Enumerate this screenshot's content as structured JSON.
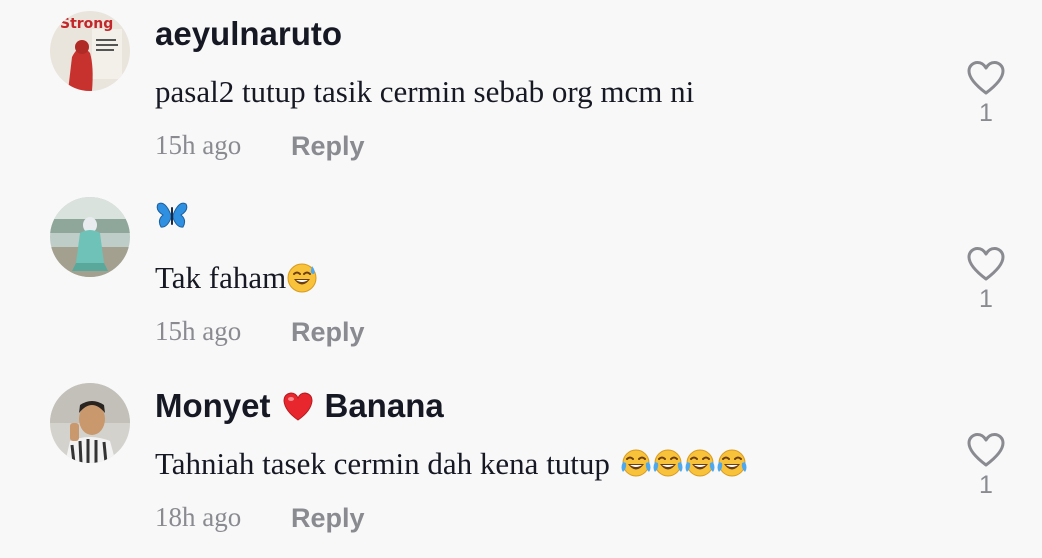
{
  "comments": [
    {
      "username": "aeyulnaruto",
      "text": "pasal2 tutup tasik cermin sebab org mcm ni",
      "time": "15h ago",
      "reply_label": "Reply",
      "like_count": "1",
      "avatar_text": "Strong"
    },
    {
      "username_emoji": "butterfly-emoji",
      "text": "Tak faham",
      "text_emoji": "grinning-sweat-emoji",
      "time": "15h ago",
      "reply_label": "Reply",
      "like_count": "1"
    },
    {
      "username_part1": "Monyet",
      "username_emoji": "red-heart-emoji",
      "username_part2": "Banana",
      "text": "Tahniah tasek cermin dah kena tutup",
      "text_emojis": [
        "tears-of-joy-emoji",
        "tears-of-joy-emoji",
        "tears-of-joy-emoji",
        "tears-of-joy-emoji"
      ],
      "time": "18h ago",
      "reply_label": "Reply",
      "like_count": "1"
    }
  ],
  "colors": {
    "background": "#f8f8f8",
    "primary_text": "#161823",
    "secondary_text": "#8a8b91",
    "heart_outline": "#8a8b91"
  }
}
